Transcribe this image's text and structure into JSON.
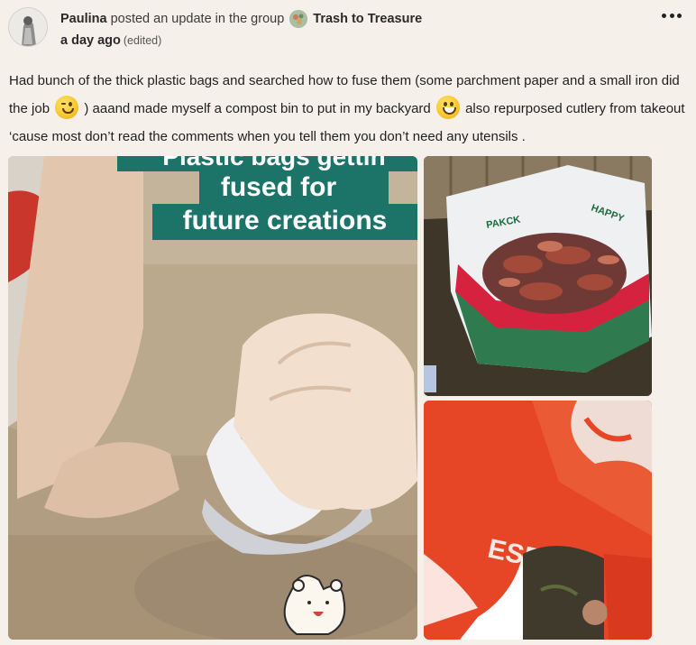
{
  "post": {
    "author": "Paulina",
    "action": "posted an update in the group",
    "group": "Trash to Treasure",
    "time": "a day ago",
    "edited": "(edited)",
    "text_part1": "Had bunch of the thick plastic bags and searched how to fuse them (some parchment paper and a small iron did the job",
    "emoji1": "winking-face",
    "text_part2": ") aaand made myself a compost bin to put in my backyard",
    "emoji2": "grinning-face",
    "text_part3": "also repurposed cutlery from takeout ‘cause most don’t read the comments when you tell them you don’t need any utensils ."
  },
  "photos": {
    "overlay_line1": "Plastic bags gettin",
    "overlay_line2": "fused for",
    "overlay_line3": "future creations"
  },
  "colors": {
    "background": "#f5f1ea",
    "overlay_band": "#1b7467",
    "bag_red": "#e84a25"
  }
}
